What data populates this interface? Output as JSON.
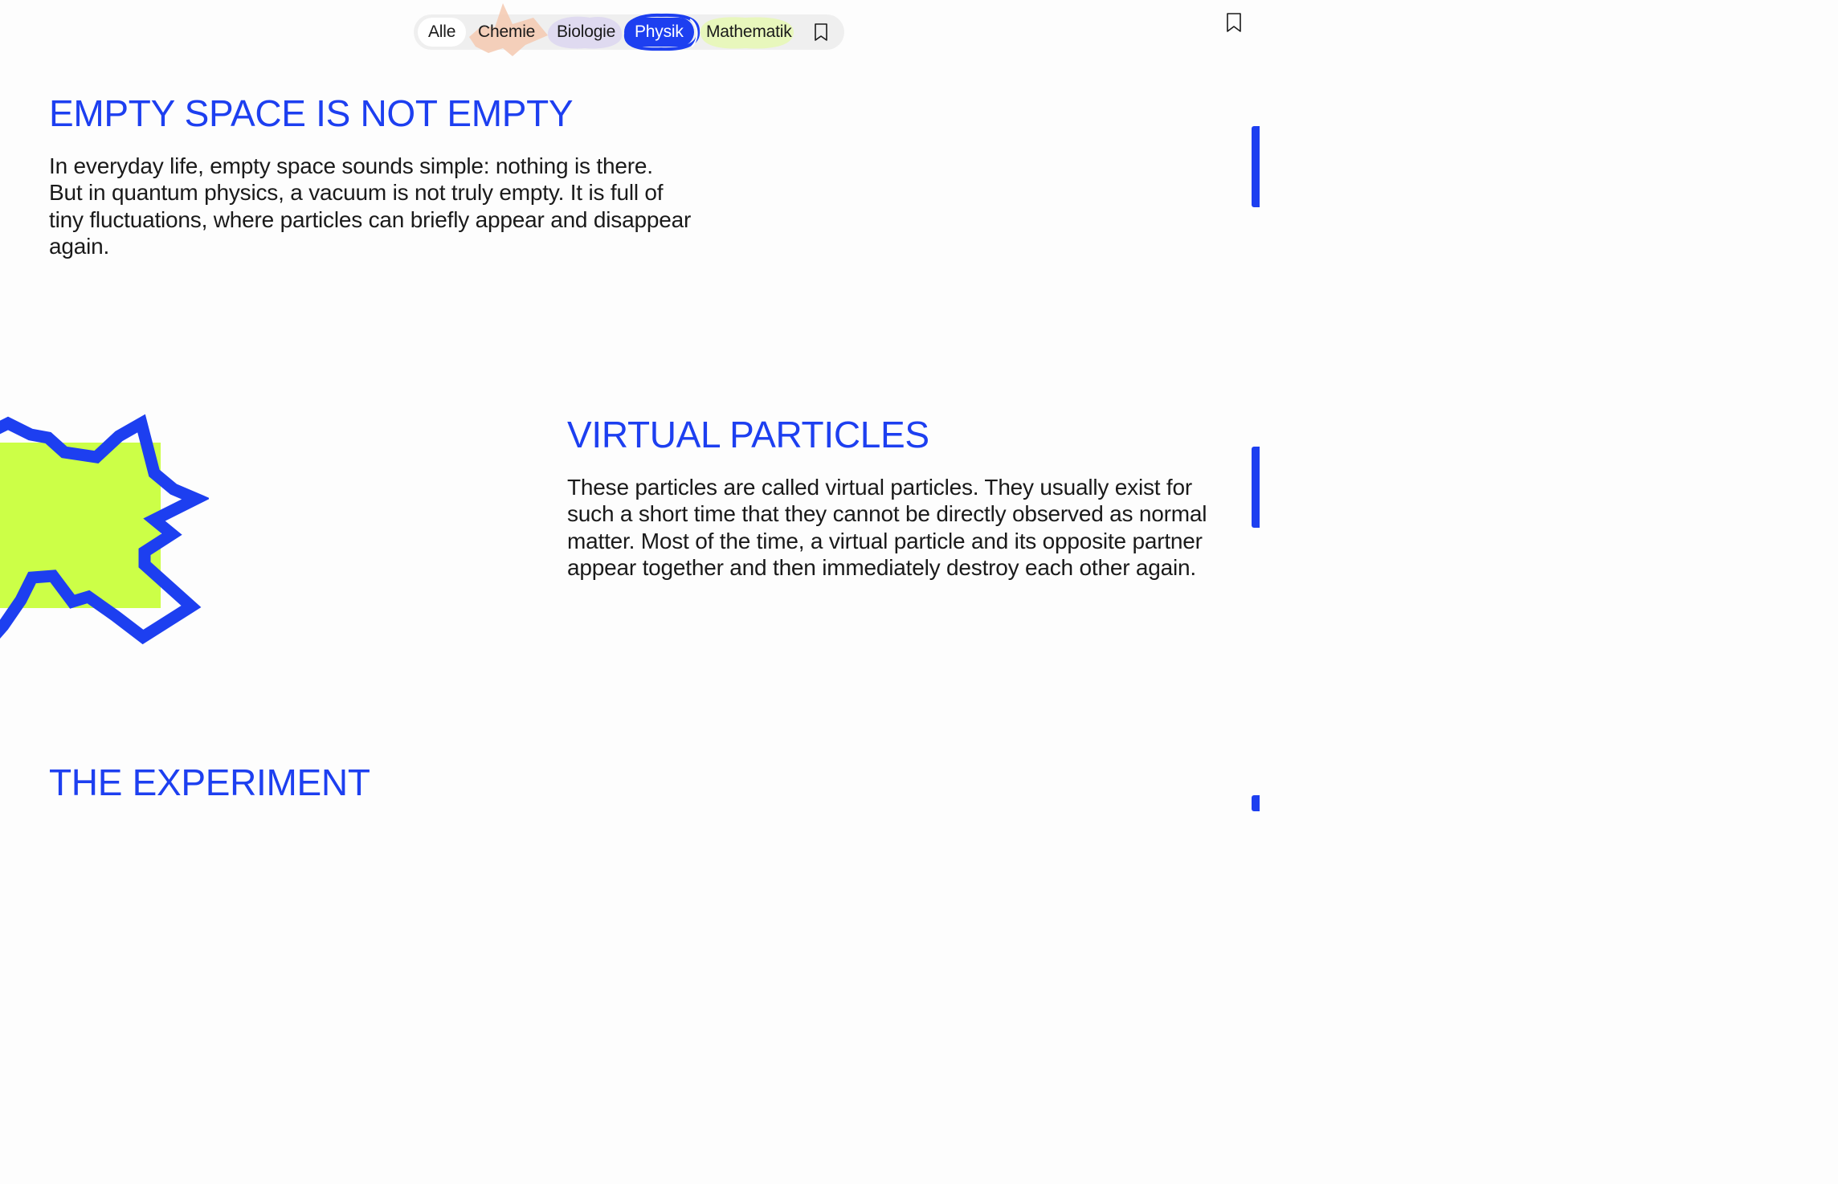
{
  "filter_bar": {
    "options": [
      {
        "label": "Alle",
        "state": "default"
      },
      {
        "label": "Chemie",
        "color": "#f4c9b0"
      },
      {
        "label": "Biologie",
        "color": "#ddd7f0"
      },
      {
        "label": "Physik",
        "state": "selected",
        "color": "#1d3ff0"
      },
      {
        "label": "Mathematik",
        "color": "#e7f7b8"
      }
    ],
    "bookmark_icon": "bookmark-icon"
  },
  "corner_icon": "bookmark-icon",
  "sections": [
    {
      "title": "EMPTY SPACE IS NOT EMPTY",
      "body": "In everyday life, empty space sounds simple: nothing is there. But in quantum physics, a vacuum is not truly empty. It is full of tiny fluctuations, where particles can briefly appear and disappear again."
    },
    {
      "title": "VIRTUAL PARTICLES",
      "body": "These particles are called virtual particles. They usually exist for such a short time that they cannot be directly observed as normal matter. Most of the time, a virtual particle and its opposite partner appear together and then immediately destroy each other again."
    },
    {
      "title": "THE EXPERIMENT"
    }
  ],
  "colors": {
    "accent": "#1d3ff0",
    "lime": "#ccff47",
    "text": "#1a1a1a",
    "background": "#fdfdfd"
  }
}
